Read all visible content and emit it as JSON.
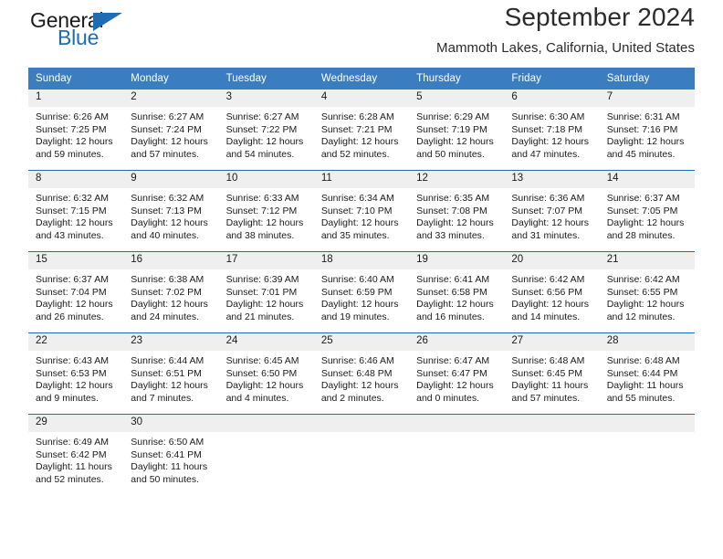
{
  "brand": {
    "name_part1": "General",
    "name_part2": "Blue",
    "triangle_color": "#1f6cb4",
    "text_color": "#1a1a1a"
  },
  "header": {
    "title": "September 2024",
    "subtitle": "Mammoth Lakes, California, United States"
  },
  "theme": {
    "header_bg": "#3a7ebf",
    "header_text": "#ffffff",
    "week_divider": "#1f6cb4",
    "daynum_strip_bg": "#efefef",
    "body_text": "#1a1a1a"
  },
  "calendar": {
    "weekday_headers": [
      "Sunday",
      "Monday",
      "Tuesday",
      "Wednesday",
      "Thursday",
      "Friday",
      "Saturday"
    ],
    "weeks": [
      [
        {
          "day": "1",
          "sunrise": "Sunrise: 6:26 AM",
          "sunset": "Sunset: 7:25 PM",
          "daylight_line1": "Daylight: 12 hours",
          "daylight_line2": "and 59 minutes."
        },
        {
          "day": "2",
          "sunrise": "Sunrise: 6:27 AM",
          "sunset": "Sunset: 7:24 PM",
          "daylight_line1": "Daylight: 12 hours",
          "daylight_line2": "and 57 minutes."
        },
        {
          "day": "3",
          "sunrise": "Sunrise: 6:27 AM",
          "sunset": "Sunset: 7:22 PM",
          "daylight_line1": "Daylight: 12 hours",
          "daylight_line2": "and 54 minutes."
        },
        {
          "day": "4",
          "sunrise": "Sunrise: 6:28 AM",
          "sunset": "Sunset: 7:21 PM",
          "daylight_line1": "Daylight: 12 hours",
          "daylight_line2": "and 52 minutes."
        },
        {
          "day": "5",
          "sunrise": "Sunrise: 6:29 AM",
          "sunset": "Sunset: 7:19 PM",
          "daylight_line1": "Daylight: 12 hours",
          "daylight_line2": "and 50 minutes."
        },
        {
          "day": "6",
          "sunrise": "Sunrise: 6:30 AM",
          "sunset": "Sunset: 7:18 PM",
          "daylight_line1": "Daylight: 12 hours",
          "daylight_line2": "and 47 minutes."
        },
        {
          "day": "7",
          "sunrise": "Sunrise: 6:31 AM",
          "sunset": "Sunset: 7:16 PM",
          "daylight_line1": "Daylight: 12 hours",
          "daylight_line2": "and 45 minutes."
        }
      ],
      [
        {
          "day": "8",
          "sunrise": "Sunrise: 6:32 AM",
          "sunset": "Sunset: 7:15 PM",
          "daylight_line1": "Daylight: 12 hours",
          "daylight_line2": "and 43 minutes."
        },
        {
          "day": "9",
          "sunrise": "Sunrise: 6:32 AM",
          "sunset": "Sunset: 7:13 PM",
          "daylight_line1": "Daylight: 12 hours",
          "daylight_line2": "and 40 minutes."
        },
        {
          "day": "10",
          "sunrise": "Sunrise: 6:33 AM",
          "sunset": "Sunset: 7:12 PM",
          "daylight_line1": "Daylight: 12 hours",
          "daylight_line2": "and 38 minutes."
        },
        {
          "day": "11",
          "sunrise": "Sunrise: 6:34 AM",
          "sunset": "Sunset: 7:10 PM",
          "daylight_line1": "Daylight: 12 hours",
          "daylight_line2": "and 35 minutes."
        },
        {
          "day": "12",
          "sunrise": "Sunrise: 6:35 AM",
          "sunset": "Sunset: 7:08 PM",
          "daylight_line1": "Daylight: 12 hours",
          "daylight_line2": "and 33 minutes."
        },
        {
          "day": "13",
          "sunrise": "Sunrise: 6:36 AM",
          "sunset": "Sunset: 7:07 PM",
          "daylight_line1": "Daylight: 12 hours",
          "daylight_line2": "and 31 minutes."
        },
        {
          "day": "14",
          "sunrise": "Sunrise: 6:37 AM",
          "sunset": "Sunset: 7:05 PM",
          "daylight_line1": "Daylight: 12 hours",
          "daylight_line2": "and 28 minutes."
        }
      ],
      [
        {
          "day": "15",
          "sunrise": "Sunrise: 6:37 AM",
          "sunset": "Sunset: 7:04 PM",
          "daylight_line1": "Daylight: 12 hours",
          "daylight_line2": "and 26 minutes."
        },
        {
          "day": "16",
          "sunrise": "Sunrise: 6:38 AM",
          "sunset": "Sunset: 7:02 PM",
          "daylight_line1": "Daylight: 12 hours",
          "daylight_line2": "and 24 minutes."
        },
        {
          "day": "17",
          "sunrise": "Sunrise: 6:39 AM",
          "sunset": "Sunset: 7:01 PM",
          "daylight_line1": "Daylight: 12 hours",
          "daylight_line2": "and 21 minutes."
        },
        {
          "day": "18",
          "sunrise": "Sunrise: 6:40 AM",
          "sunset": "Sunset: 6:59 PM",
          "daylight_line1": "Daylight: 12 hours",
          "daylight_line2": "and 19 minutes."
        },
        {
          "day": "19",
          "sunrise": "Sunrise: 6:41 AM",
          "sunset": "Sunset: 6:58 PM",
          "daylight_line1": "Daylight: 12 hours",
          "daylight_line2": "and 16 minutes."
        },
        {
          "day": "20",
          "sunrise": "Sunrise: 6:42 AM",
          "sunset": "Sunset: 6:56 PM",
          "daylight_line1": "Daylight: 12 hours",
          "daylight_line2": "and 14 minutes."
        },
        {
          "day": "21",
          "sunrise": "Sunrise: 6:42 AM",
          "sunset": "Sunset: 6:55 PM",
          "daylight_line1": "Daylight: 12 hours",
          "daylight_line2": "and 12 minutes."
        }
      ],
      [
        {
          "day": "22",
          "sunrise": "Sunrise: 6:43 AM",
          "sunset": "Sunset: 6:53 PM",
          "daylight_line1": "Daylight: 12 hours",
          "daylight_line2": "and 9 minutes."
        },
        {
          "day": "23",
          "sunrise": "Sunrise: 6:44 AM",
          "sunset": "Sunset: 6:51 PM",
          "daylight_line1": "Daylight: 12 hours",
          "daylight_line2": "and 7 minutes."
        },
        {
          "day": "24",
          "sunrise": "Sunrise: 6:45 AM",
          "sunset": "Sunset: 6:50 PM",
          "daylight_line1": "Daylight: 12 hours",
          "daylight_line2": "and 4 minutes."
        },
        {
          "day": "25",
          "sunrise": "Sunrise: 6:46 AM",
          "sunset": "Sunset: 6:48 PM",
          "daylight_line1": "Daylight: 12 hours",
          "daylight_line2": "and 2 minutes."
        },
        {
          "day": "26",
          "sunrise": "Sunrise: 6:47 AM",
          "sunset": "Sunset: 6:47 PM",
          "daylight_line1": "Daylight: 12 hours",
          "daylight_line2": "and 0 minutes."
        },
        {
          "day": "27",
          "sunrise": "Sunrise: 6:48 AM",
          "sunset": "Sunset: 6:45 PM",
          "daylight_line1": "Daylight: 11 hours",
          "daylight_line2": "and 57 minutes."
        },
        {
          "day": "28",
          "sunrise": "Sunrise: 6:48 AM",
          "sunset": "Sunset: 6:44 PM",
          "daylight_line1": "Daylight: 11 hours",
          "daylight_line2": "and 55 minutes."
        }
      ],
      [
        {
          "day": "29",
          "sunrise": "Sunrise: 6:49 AM",
          "sunset": "Sunset: 6:42 PM",
          "daylight_line1": "Daylight: 11 hours",
          "daylight_line2": "and 52 minutes."
        },
        {
          "day": "30",
          "sunrise": "Sunrise: 6:50 AM",
          "sunset": "Sunset: 6:41 PM",
          "daylight_line1": "Daylight: 11 hours",
          "daylight_line2": "and 50 minutes."
        },
        {
          "day": "",
          "sunrise": "",
          "sunset": "",
          "daylight_line1": "",
          "daylight_line2": ""
        },
        {
          "day": "",
          "sunrise": "",
          "sunset": "",
          "daylight_line1": "",
          "daylight_line2": ""
        },
        {
          "day": "",
          "sunrise": "",
          "sunset": "",
          "daylight_line1": "",
          "daylight_line2": ""
        },
        {
          "day": "",
          "sunrise": "",
          "sunset": "",
          "daylight_line1": "",
          "daylight_line2": ""
        },
        {
          "day": "",
          "sunrise": "",
          "sunset": "",
          "daylight_line1": "",
          "daylight_line2": ""
        }
      ]
    ]
  }
}
